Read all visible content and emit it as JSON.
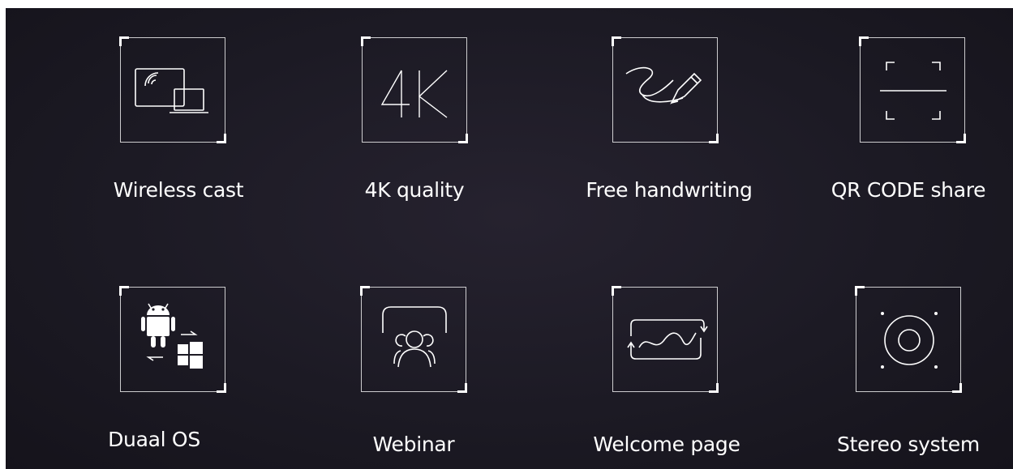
{
  "features": [
    {
      "label": "Wireless cast",
      "icon": "wireless-cast-icon"
    },
    {
      "label": "4K quality",
      "icon": "4k-icon",
      "icon_text": "4K"
    },
    {
      "label": "Free handwriting",
      "icon": "pen-icon"
    },
    {
      "label": "QR CODE share",
      "icon": "qr-scan-icon"
    },
    {
      "label": "Duaal OS",
      "icon": "dual-os-icon"
    },
    {
      "label": "Webinar",
      "icon": "webinar-group-icon"
    },
    {
      "label": "Welcome page",
      "icon": "welcome-page-icon"
    },
    {
      "label": "Stereo system",
      "icon": "speaker-icon"
    }
  ],
  "colors": {
    "background": "#1c1a24",
    "foreground": "#ffffff"
  }
}
